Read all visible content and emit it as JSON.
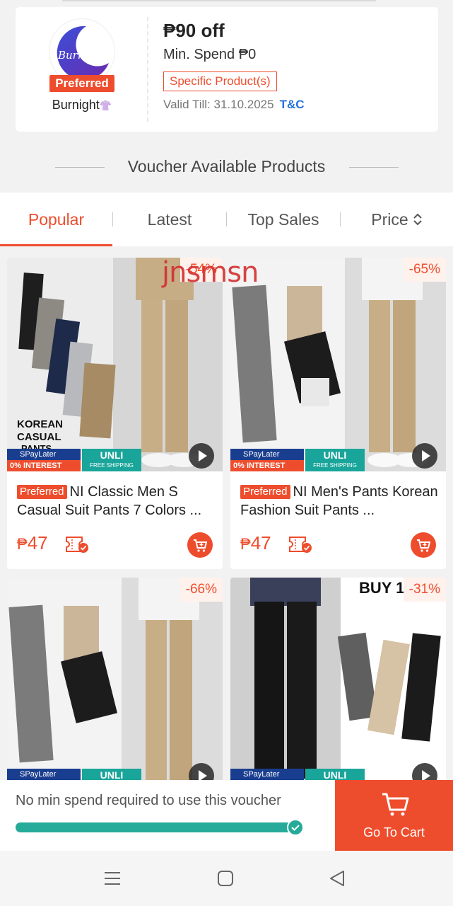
{
  "voucher": {
    "brand_logo_text": "Burnight",
    "preferred_label": "Preferred",
    "brand_name": "Burnight",
    "brand_emoji": "👚",
    "title": "₱90 off",
    "min_spend": "Min. Spend ₱0",
    "tag": "Specific Product(s)",
    "valid_till": "Valid Till: 31.10.2025",
    "tc_link": "T&C"
  },
  "section": {
    "heading": "Voucher Available Products"
  },
  "tabs": [
    {
      "label": "Popular",
      "active": true
    },
    {
      "label": "Latest",
      "active": false
    },
    {
      "label": "Top Sales",
      "active": false
    },
    {
      "label": "Price",
      "active": false
    }
  ],
  "watermark": "jnsmsn",
  "products": [
    {
      "discount": "-54%",
      "image_text": "KOREAN CASUAL PANTS",
      "spaylater": "SPayLater",
      "interest": "0% INTEREST",
      "unli": "UNLI",
      "free_shipping": "FREE SHIPPING",
      "preferred": "Preferred",
      "title": "NI Classic Men S Casual Suit Pants 7 Colors ...",
      "price_currency": "₱",
      "price": "47"
    },
    {
      "discount": "-65%",
      "spaylater": "SPayLater",
      "interest": "0% INTEREST",
      "unli": "UNLI",
      "free_shipping": "FREE SHIPPING",
      "preferred": "Preferred",
      "title": "NI Men's Pants Korean Fashion Suit Pants ...",
      "price_currency": "₱",
      "price": "47"
    },
    {
      "discount": "-66%",
      "spaylater": "SPayLater",
      "unli": "UNLI"
    },
    {
      "discount": "-31%",
      "image_text": "BUY 1 TAKE 1",
      "spaylater": "SPayLater",
      "unli": "UNLI"
    }
  ],
  "bottom_bar": {
    "message": "No min spend required to use this voucher",
    "progress": 1.0,
    "cart_label": "Go To Cart"
  },
  "colors": {
    "accent": "#ee4d2d",
    "progress": "#26aa99",
    "link": "#2673dd"
  }
}
